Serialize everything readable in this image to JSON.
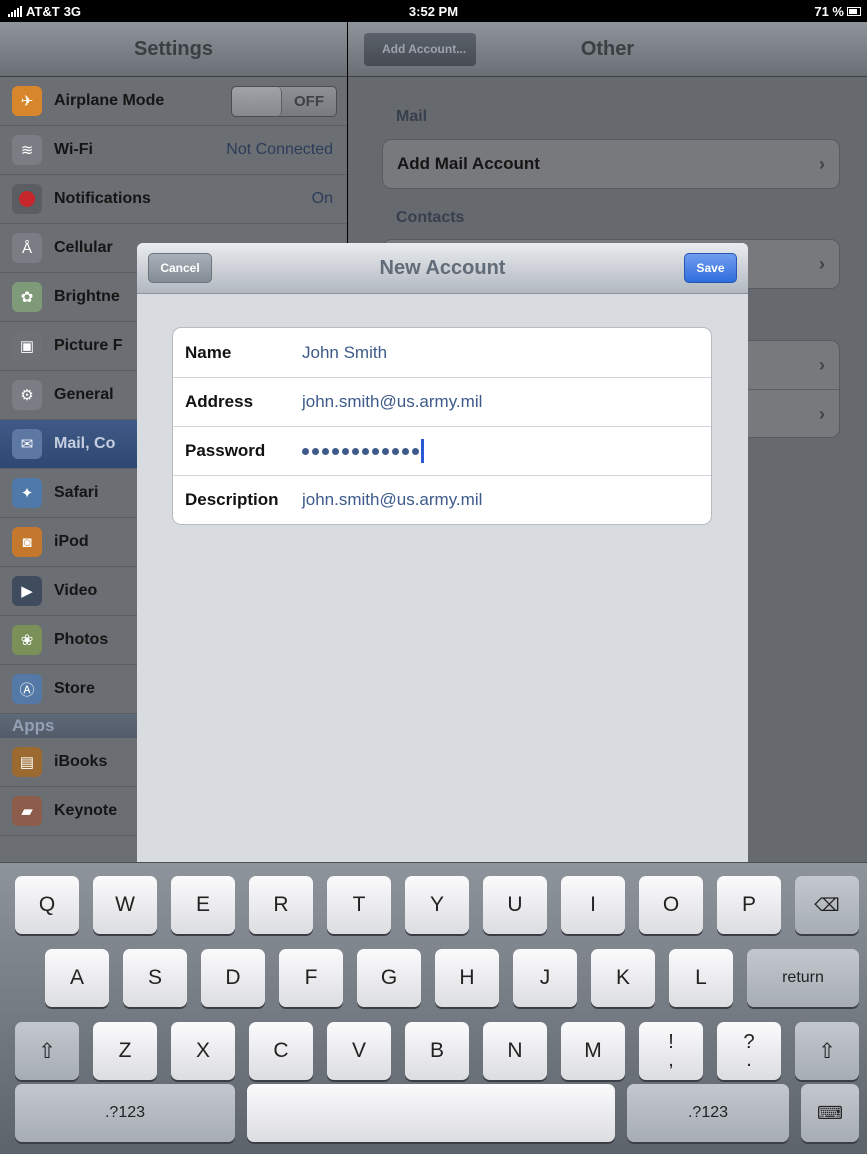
{
  "status_bar": {
    "carrier": "AT&T",
    "network": "3G",
    "time": "3:52 PM",
    "battery": "71 %"
  },
  "settings": {
    "title": "Settings",
    "items": [
      {
        "label": "Airplane Mode",
        "value": "OFF",
        "icon": "airplane-icon"
      },
      {
        "label": "Wi-Fi",
        "value": "Not Connected",
        "icon": "wifi-icon"
      },
      {
        "label": "Notifications",
        "value": "On",
        "icon": "notifications-icon"
      },
      {
        "label": "Cellular",
        "value": "",
        "icon": "cellular-icon"
      },
      {
        "label": "Brightne",
        "value": "",
        "icon": "brightness-icon"
      },
      {
        "label": "Picture F",
        "value": "",
        "icon": "picture-frame-icon"
      },
      {
        "label": "General",
        "value": "",
        "icon": "general-icon"
      },
      {
        "label": "Mail, Co",
        "value": "",
        "icon": "mail-icon"
      },
      {
        "label": "Safari",
        "value": "",
        "icon": "safari-icon"
      },
      {
        "label": "iPod",
        "value": "",
        "icon": "ipod-icon"
      },
      {
        "label": "Video",
        "value": "",
        "icon": "video-icon"
      },
      {
        "label": "Photos",
        "value": "",
        "icon": "photos-icon"
      },
      {
        "label": "Store",
        "value": "",
        "icon": "store-icon"
      }
    ],
    "apps_header": "Apps",
    "apps": [
      {
        "label": "iBooks",
        "icon": "ibooks-icon"
      },
      {
        "label": "Keynote",
        "icon": "keynote-icon"
      }
    ]
  },
  "detail": {
    "back_label": "Add Account...",
    "title": "Other",
    "mail_header": "Mail",
    "add_mail_account": "Add Mail Account",
    "contacts_header": "Contacts"
  },
  "modal": {
    "title": "New Account",
    "cancel_label": "Cancel",
    "save_label": "Save",
    "fields": [
      {
        "label": "Name",
        "value": "John Smith"
      },
      {
        "label": "Address",
        "value": "john.smith@us.army.mil"
      },
      {
        "label": "Password",
        "value": "",
        "masked_length": 12
      },
      {
        "label": "Description",
        "value": "john.smith@us.army.mil"
      }
    ]
  },
  "keyboard": {
    "row1": [
      "Q",
      "W",
      "E",
      "R",
      "T",
      "Y",
      "U",
      "I",
      "O",
      "P"
    ],
    "row2": [
      "A",
      "S",
      "D",
      "F",
      "G",
      "H",
      "J",
      "K",
      "L"
    ],
    "row3": [
      "Z",
      "X",
      "C",
      "V",
      "B",
      "N",
      "M"
    ],
    "return_label": "return",
    "numbers_label": ".?123",
    "exclaim_top": "!",
    "exclaim_bottom": ",",
    "question_top": "?",
    "question_bottom": "."
  }
}
